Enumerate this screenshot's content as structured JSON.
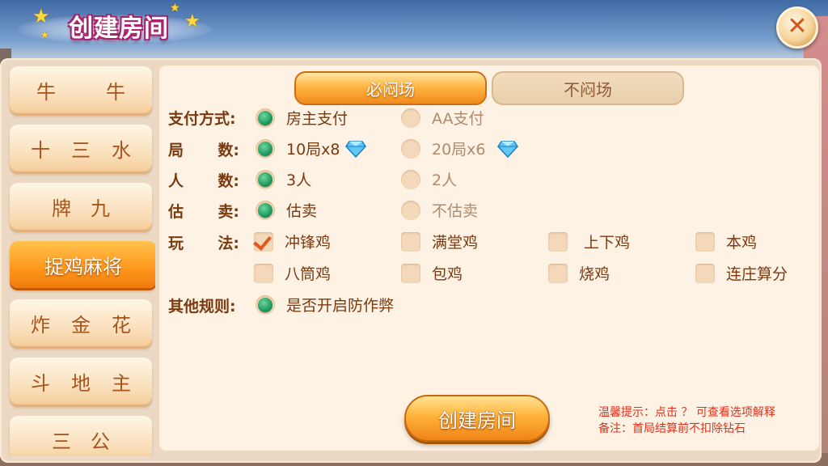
{
  "window": {
    "title": "创建房间"
  },
  "close_icon": "close-icon",
  "sidebar": {
    "items": [
      {
        "label_chars": [
          "牛",
          "牛"
        ],
        "active": false
      },
      {
        "label_chars": [
          "十",
          "三",
          "水"
        ],
        "active": false
      },
      {
        "label_chars": [
          "牌",
          "九"
        ],
        "active": false
      },
      {
        "label": "捉鸡麻将",
        "active": true
      },
      {
        "label_chars": [
          "炸",
          "金",
          "花"
        ],
        "active": false
      },
      {
        "label_chars": [
          "斗",
          "地",
          "主"
        ],
        "active": false
      },
      {
        "label_chars": [
          "三",
          "公"
        ],
        "active": false
      }
    ]
  },
  "tabs": {
    "active": "必闷场",
    "inactive": "不闷场"
  },
  "form": {
    "payment": {
      "label": "支付方式:",
      "opt1": "房主支付",
      "opt2": "AA支付",
      "selected": 1
    },
    "rounds": {
      "label_chars": [
        "局",
        "数:"
      ],
      "opt1": "10局x8",
      "opt2": "20局x6",
      "selected": 1
    },
    "players": {
      "label_chars": [
        "人",
        "数:"
      ],
      "opt1": "3人",
      "opt2": "2人",
      "selected": 1
    },
    "sell": {
      "label_chars": [
        "估",
        "卖:"
      ],
      "opt1": "估卖",
      "opt2": "不估卖",
      "selected": 1
    },
    "play": {
      "label_chars": [
        "玩",
        "法:"
      ],
      "options": [
        {
          "text": "冲锋鸡",
          "checked": true
        },
        {
          "text": "满堂鸡",
          "checked": false
        },
        {
          "text": "上下鸡",
          "checked": false
        },
        {
          "text": "本鸡",
          "checked": false
        },
        {
          "text": "八筒鸡",
          "checked": false
        },
        {
          "text": "包鸡",
          "checked": false
        },
        {
          "text": "烧鸡",
          "checked": false
        },
        {
          "text": "连庄算分",
          "checked": false
        }
      ]
    },
    "other": {
      "label": "其他规则:",
      "opt1": "是否开启防作弊",
      "selected": 1
    }
  },
  "create_button": "创建房间",
  "tips": {
    "line1": "温馨提示：点击 ？ 可查看选项解释",
    "line2": "备注：首局结算前不扣除钻石"
  },
  "colors": {
    "accent_orange": "#f08418",
    "radio_green": "#1f9a5e",
    "label_brown": "#7a3a10",
    "tip_red": "#e1301c"
  }
}
